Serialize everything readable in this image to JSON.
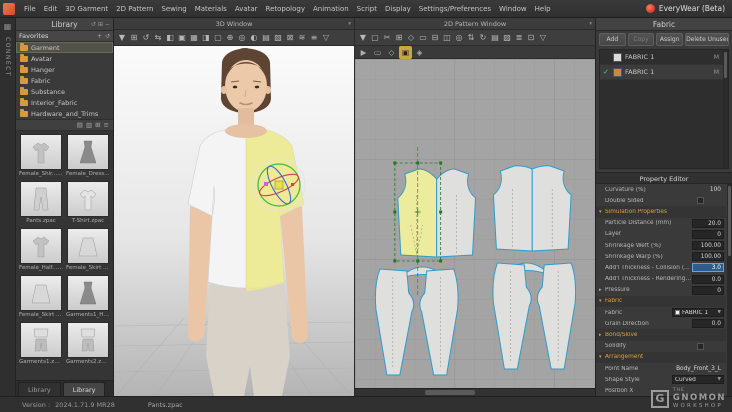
{
  "app": {
    "title": "EveryWear (Beta)"
  },
  "menubar": {
    "items": [
      "File",
      "Edit",
      "3D Garment",
      "2D Pattern",
      "Sewing",
      "Materials",
      "Avatar",
      "Retopology",
      "Animation",
      "Script",
      "Display",
      "Settings/Preferences",
      "Window",
      "Help"
    ]
  },
  "connect": {
    "label": "CONNECT",
    "icon": "▦"
  },
  "library": {
    "title": "Library",
    "title_icons": [
      "↺",
      "⊞",
      "−"
    ],
    "favorites": {
      "label": "Favorites",
      "icons": [
        "+",
        "↺"
      ],
      "folders": [
        {
          "name": "Garment",
          "state": "selected"
        },
        {
          "name": "Avatar",
          "state": ""
        },
        {
          "name": "Hanger",
          "state": ""
        },
        {
          "name": "Fabric",
          "state": ""
        },
        {
          "name": "Substance",
          "state": ""
        },
        {
          "name": "Interior_Fabric",
          "state": ""
        },
        {
          "name": "Hardware_and_Trims",
          "state": ""
        }
      ]
    },
    "mini_icons": [
      "▤",
      "▥",
      "⊞",
      "≡"
    ],
    "items": [
      {
        "name": "Female_Shir...ess.zpac",
        "icon": "#g-shirt"
      },
      {
        "name": "Female_Dress.zpac",
        "icon": "#g-dress"
      },
      {
        "name": "Pants.zpac",
        "icon": "#g-pants"
      },
      {
        "name": "T-Shirt.zpac",
        "icon": "#g-tshirt"
      },
      {
        "name": "Female_Half...s.zpac",
        "icon": "#g-shirt"
      },
      {
        "name": "Female_Skirt 1.zpac",
        "icon": "#g-skirt"
      },
      {
        "name": "Female_Skirt 2.zpac",
        "icon": "#g-skirt"
      },
      {
        "name": "Garments1_Hanse.zpac",
        "icon": "#g-dress"
      },
      {
        "name": "Garments1.zpac",
        "icon": "#g-outfit"
      },
      {
        "name": "Garments2.zpac",
        "icon": "#g-outfit"
      }
    ],
    "tabs": [
      {
        "label": "Library",
        "state": ""
      },
      {
        "label": "Library",
        "state": "active"
      }
    ]
  },
  "window3d": {
    "title": "3D Window",
    "corner": "▾",
    "toolbar": [
      "▼",
      "⊞",
      "↺",
      "⇆",
      "◧",
      "▣",
      "▦",
      "◨",
      "▢",
      "⊕",
      "◎",
      "◐",
      "▤",
      "▧",
      "⊠",
      "≋",
      "≡",
      "▽"
    ]
  },
  "window2d": {
    "title": "2D Pattern Window",
    "corner": "▾",
    "toolbar": [
      "▼",
      "▢",
      "✂",
      "⊞",
      "◇",
      "▭",
      "⊟",
      "◫",
      "◎",
      "⇅",
      "↻",
      "▤",
      "▨",
      "≣",
      "⊡",
      "▽"
    ],
    "toolbar2": [
      {
        "glyph": "▶",
        "state": ""
      },
      {
        "glyph": "▭",
        "state": ""
      },
      {
        "glyph": "◇",
        "state": ""
      },
      {
        "glyph": "▣",
        "state": "active"
      },
      {
        "glyph": "◈",
        "state": ""
      }
    ]
  },
  "fabric": {
    "title": "Fabric",
    "buttons": [
      {
        "label": "Add",
        "cls": ""
      },
      {
        "label": "Copy",
        "cls": "disabled"
      },
      {
        "label": "Assign",
        "cls": ""
      },
      {
        "label": "Delete Unused",
        "cls": "wide"
      }
    ],
    "rows": [
      {
        "check": "",
        "swatch_style": "background:#dcdcdc",
        "name": "FABRIC 1",
        "badge": "M",
        "state": ""
      },
      {
        "check": "✓",
        "swatch_style": "background:#c98a3f",
        "name": "FABRIC 1",
        "badge": "M",
        "state": "selected"
      }
    ]
  },
  "property_editor": {
    "title": "Property Editor",
    "rows": [
      {
        "label": "Curvature (%)",
        "value": "100",
        "type": "r-value",
        "arrow": ""
      },
      {
        "label": "Double Sided",
        "value": "",
        "type": "r-checkbox",
        "arrow": ""
      },
      {
        "label": "Simulation Properties",
        "value": "",
        "type": "r-section",
        "arrow": "▾"
      },
      {
        "label": "Particle Distance (mm)",
        "value": "20.0",
        "type": "r-input",
        "arrow": ""
      },
      {
        "label": "Layer",
        "value": "0",
        "type": "r-input",
        "arrow": ""
      },
      {
        "label": "Shrinkage Weft (%)",
        "value": "100.00",
        "type": "r-input",
        "arrow": ""
      },
      {
        "label": "Shrinkage Warp (%)",
        "value": "100.00",
        "type": "r-input",
        "arrow": ""
      },
      {
        "label": "Add'l Thickness - Collision (mm)",
        "value": "3.0",
        "type": "r-input-active",
        "arrow": ""
      },
      {
        "label": "Add'l Thickness - Rendering (mm)",
        "value": "0.0",
        "type": "r-input",
        "arrow": ""
      },
      {
        "label": "Pressure",
        "value": "0",
        "type": "r-input",
        "arrow": "▸"
      },
      {
        "label": "Fabric",
        "value": "",
        "type": "r-section",
        "arrow": "▾"
      },
      {
        "label": "Fabric",
        "value": "FABRIC 1",
        "type": "r-dropdown",
        "arrow": "",
        "swatch_on": "on"
      },
      {
        "label": "Grain Direction",
        "value": "0.0",
        "type": "r-input",
        "arrow": ""
      },
      {
        "label": "Bond/Skive",
        "value": "",
        "type": "r-section",
        "arrow": "▸"
      },
      {
        "label": "Solidify",
        "value": "",
        "type": "r-checkbox",
        "arrow": ""
      },
      {
        "label": "Arrangement",
        "value": "",
        "type": "r-section",
        "arrow": "▾"
      },
      {
        "label": "Point Name",
        "value": "Body_Front_3_L",
        "type": "r-value",
        "arrow": ""
      },
      {
        "label": "Shape Style",
        "value": "Curved",
        "type": "r-dropdown",
        "arrow": ""
      },
      {
        "label": "Position X",
        "value": "",
        "type": "r-value",
        "arrow": ""
      }
    ]
  },
  "statusbar": {
    "version_label": "Version :",
    "version": "2024.1.71.9 MR28",
    "file": "Pants.zpac"
  },
  "watermark": {
    "logo": "G",
    "the": "THE",
    "name": "GNOMON",
    "sub": "WORKSHOP"
  },
  "colors": {
    "accent_orange": "#dfa040",
    "selection_blue": "#2d5c8e",
    "pattern_stroke": "#2f9dc9",
    "selected_pattern_fill": "#edeb9e",
    "gizmo_green": "#44bb44",
    "gizmo_red": "#cc4444"
  }
}
